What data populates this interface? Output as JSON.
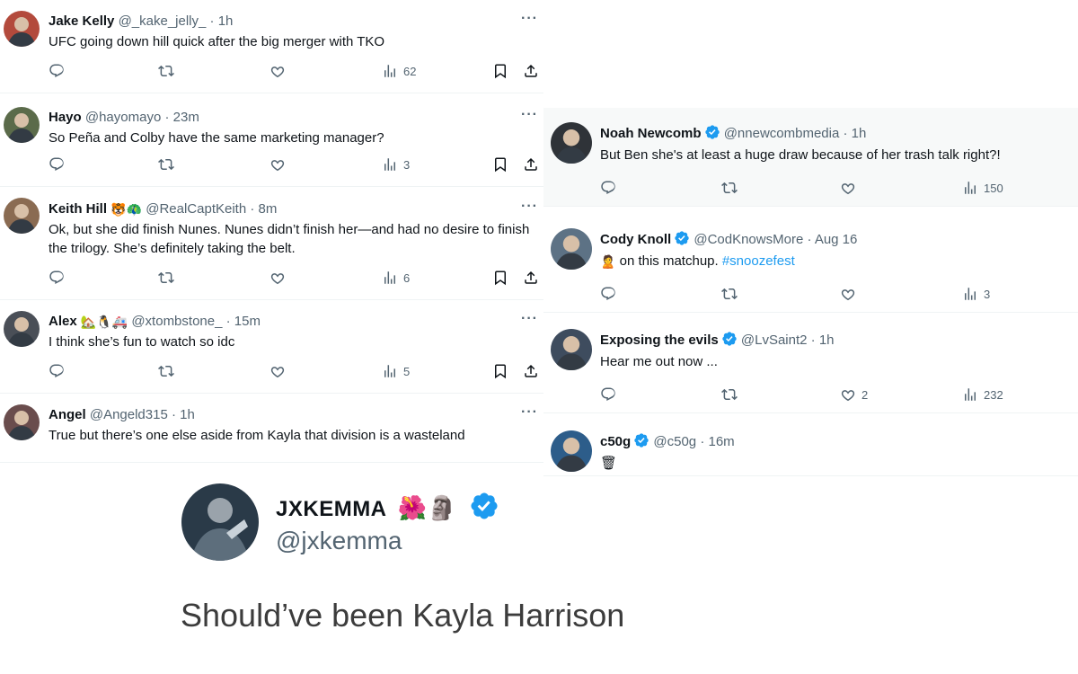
{
  "left_tweets": [
    {
      "name": "Jake Kelly",
      "emoji": "",
      "handle": "@_kake_jelly_",
      "time": "1h",
      "text": "UFC going down hill quick after the big merger with TKO",
      "views": "62",
      "likes": ""
    },
    {
      "name": "Hayo",
      "emoji": "",
      "handle": "@hayomayo",
      "time": "23m",
      "text": "So Peña and Colby have the same marketing manager?",
      "views": "3",
      "likes": ""
    },
    {
      "name": "Keith Hill",
      "emoji": "🐯🦚",
      "handle": "@RealCaptKeith",
      "time": "8m",
      "text": "Ok, but she did finish Nunes. Nunes didn’t finish her—and had no desire to finish the trilogy. She’s definitely taking the belt.",
      "views": "6",
      "likes": ""
    },
    {
      "name": "Alex",
      "emoji": "🏡🐧🚑",
      "handle": "@xtombstone_",
      "time": "15m",
      "text": "I think she’s fun to watch so idc",
      "views": "5",
      "likes": ""
    },
    {
      "name": "Angel",
      "emoji": "",
      "handle": "@Angeld315",
      "time": "1h",
      "text": "True but there’s one else aside from Kayla that division is a wasteland",
      "views": "",
      "likes": ""
    }
  ],
  "right_tweets": [
    {
      "name": "Noah Newcomb",
      "verified": true,
      "handle": "@nnewcombmedia",
      "time": "1h",
      "text": "But Ben she's at least a huge draw because of her trash talk right?!",
      "views": "150",
      "likes": ""
    },
    {
      "name": "Cody Knoll",
      "verified": true,
      "handle": "@CodKnowsMore",
      "time": "Aug 16",
      "emoji_prefix": "🙎",
      "text": "on this matchup.",
      "hashtag": "#snoozefest",
      "views": "3",
      "likes": ""
    },
    {
      "name": "Exposing the evils",
      "verified": true,
      "handle": "@LvSaint2",
      "time": "1h",
      "text": "Hear me out now ...",
      "views": "232",
      "likes": "2"
    },
    {
      "name": "c50g",
      "verified": true,
      "handle": "@c50g",
      "time": "16m",
      "text": "🗑",
      "views": "",
      "likes": ""
    }
  ],
  "featured": {
    "name": "JXKEMMA",
    "emoji": "🌺🗿",
    "handle": "@jxkemma",
    "text": "Should’ve been Kayla Harrison"
  },
  "more_glyph": "···",
  "dot": "·",
  "colors": {
    "accent": "#1d9bf0",
    "muted": "#536471",
    "text": "#0f1419",
    "right_highlight": "#f7f9f9"
  },
  "icons": [
    "reply-icon",
    "retweet-icon",
    "like-icon",
    "views-icon",
    "bookmark-icon",
    "share-icon",
    "more-icon",
    "verified-icon"
  ]
}
